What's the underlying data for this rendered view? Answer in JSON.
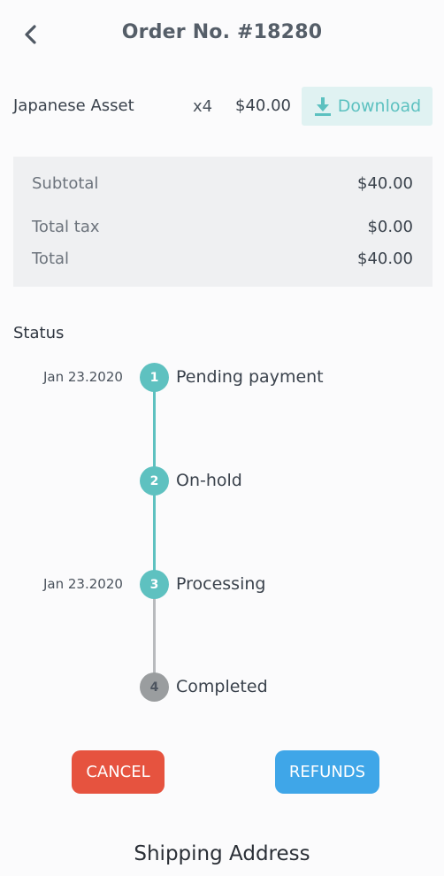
{
  "header": {
    "back_icon": "chevron-left-icon",
    "title": "Order No. #18280"
  },
  "order_item": {
    "name": "Japanese Asset",
    "quantity": "x4",
    "price": "$40.00",
    "download_label": "Download",
    "download_icon": "download-icon"
  },
  "summary": {
    "subtotal_label": "Subtotal",
    "subtotal_value": "$40.00",
    "tax_label": "Total tax",
    "tax_value": "$0.00",
    "total_label": "Total",
    "total_value": "$40.00"
  },
  "status": {
    "heading": "Status",
    "steps": [
      {
        "number": "1",
        "label": "Pending payment",
        "date": "Jan 23.2020",
        "state": "done"
      },
      {
        "number": "2",
        "label": "On-hold",
        "date": "",
        "state": "done"
      },
      {
        "number": "3",
        "label": "Processing",
        "date": "Jan 23.2020",
        "state": "done"
      },
      {
        "number": "4",
        "label": "Completed",
        "date": "",
        "state": "pending"
      }
    ]
  },
  "actions": {
    "cancel_label": "CANCEL",
    "refunds_label": "REFUNDS"
  },
  "shipping": {
    "heading": "Shipping Address"
  },
  "colors": {
    "accent": "#5ec1c0",
    "pending": "#9a9d9f",
    "cancel": "#e6533f",
    "refunds": "#3fa6e8"
  }
}
